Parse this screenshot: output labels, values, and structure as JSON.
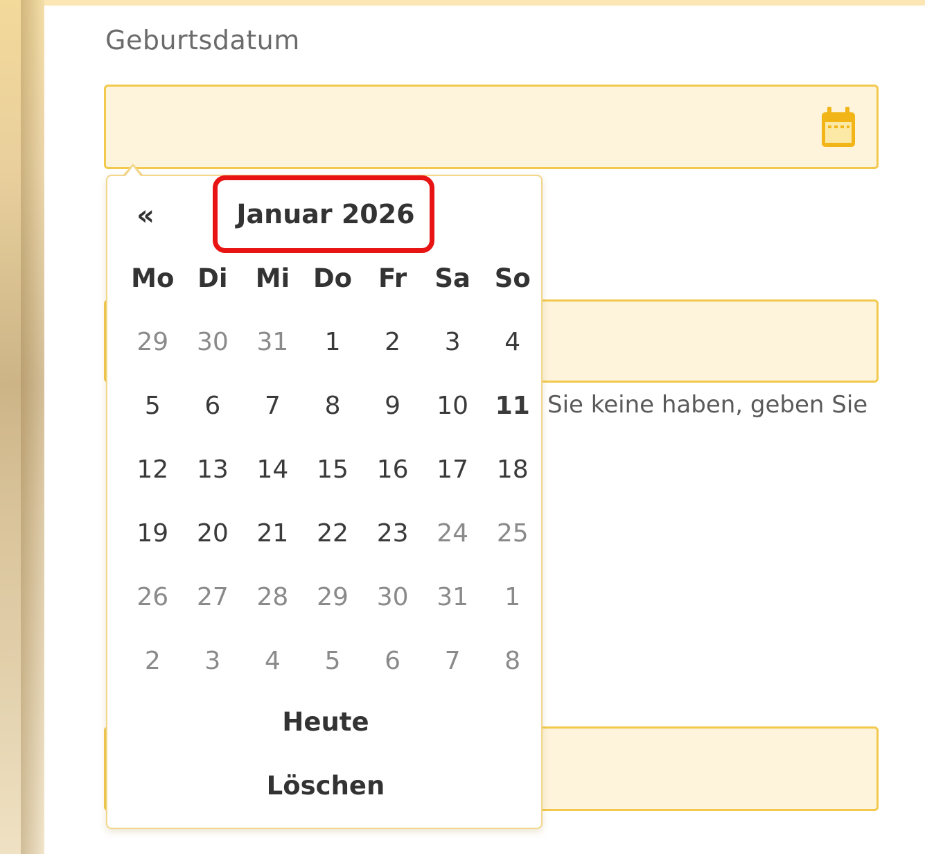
{
  "form": {
    "birthdate_label": "Geburtsdatum",
    "birthdate_value": "",
    "second_field_value": "",
    "third_field_value": "",
    "helper_text": "Sie keine haben, geben Sie"
  },
  "colors": {
    "accent": "#f2c94c",
    "field_bg": "#fef4dc",
    "highlight": "#e81414"
  },
  "datepicker": {
    "prev_label": "«",
    "month_title": "Januar 2026",
    "weekdays": [
      "Mo",
      "Di",
      "Mi",
      "Do",
      "Fr",
      "Sa",
      "So"
    ],
    "weeks": [
      [
        "29",
        "30",
        "31",
        "1",
        "2",
        "3",
        "4"
      ],
      [
        "5",
        "6",
        "7",
        "8",
        "9",
        "10",
        "11"
      ],
      [
        "12",
        "13",
        "14",
        "15",
        "16",
        "17",
        "18"
      ],
      [
        "19",
        "20",
        "21",
        "22",
        "23",
        "24",
        "25"
      ],
      [
        "26",
        "27",
        "28",
        "29",
        "30",
        "31",
        "1"
      ],
      [
        "2",
        "3",
        "4",
        "5",
        "6",
        "7",
        "8"
      ]
    ],
    "today_label": "Heute",
    "clear_label": "Löschen"
  },
  "icons": {
    "calendar": "calendar-icon"
  }
}
